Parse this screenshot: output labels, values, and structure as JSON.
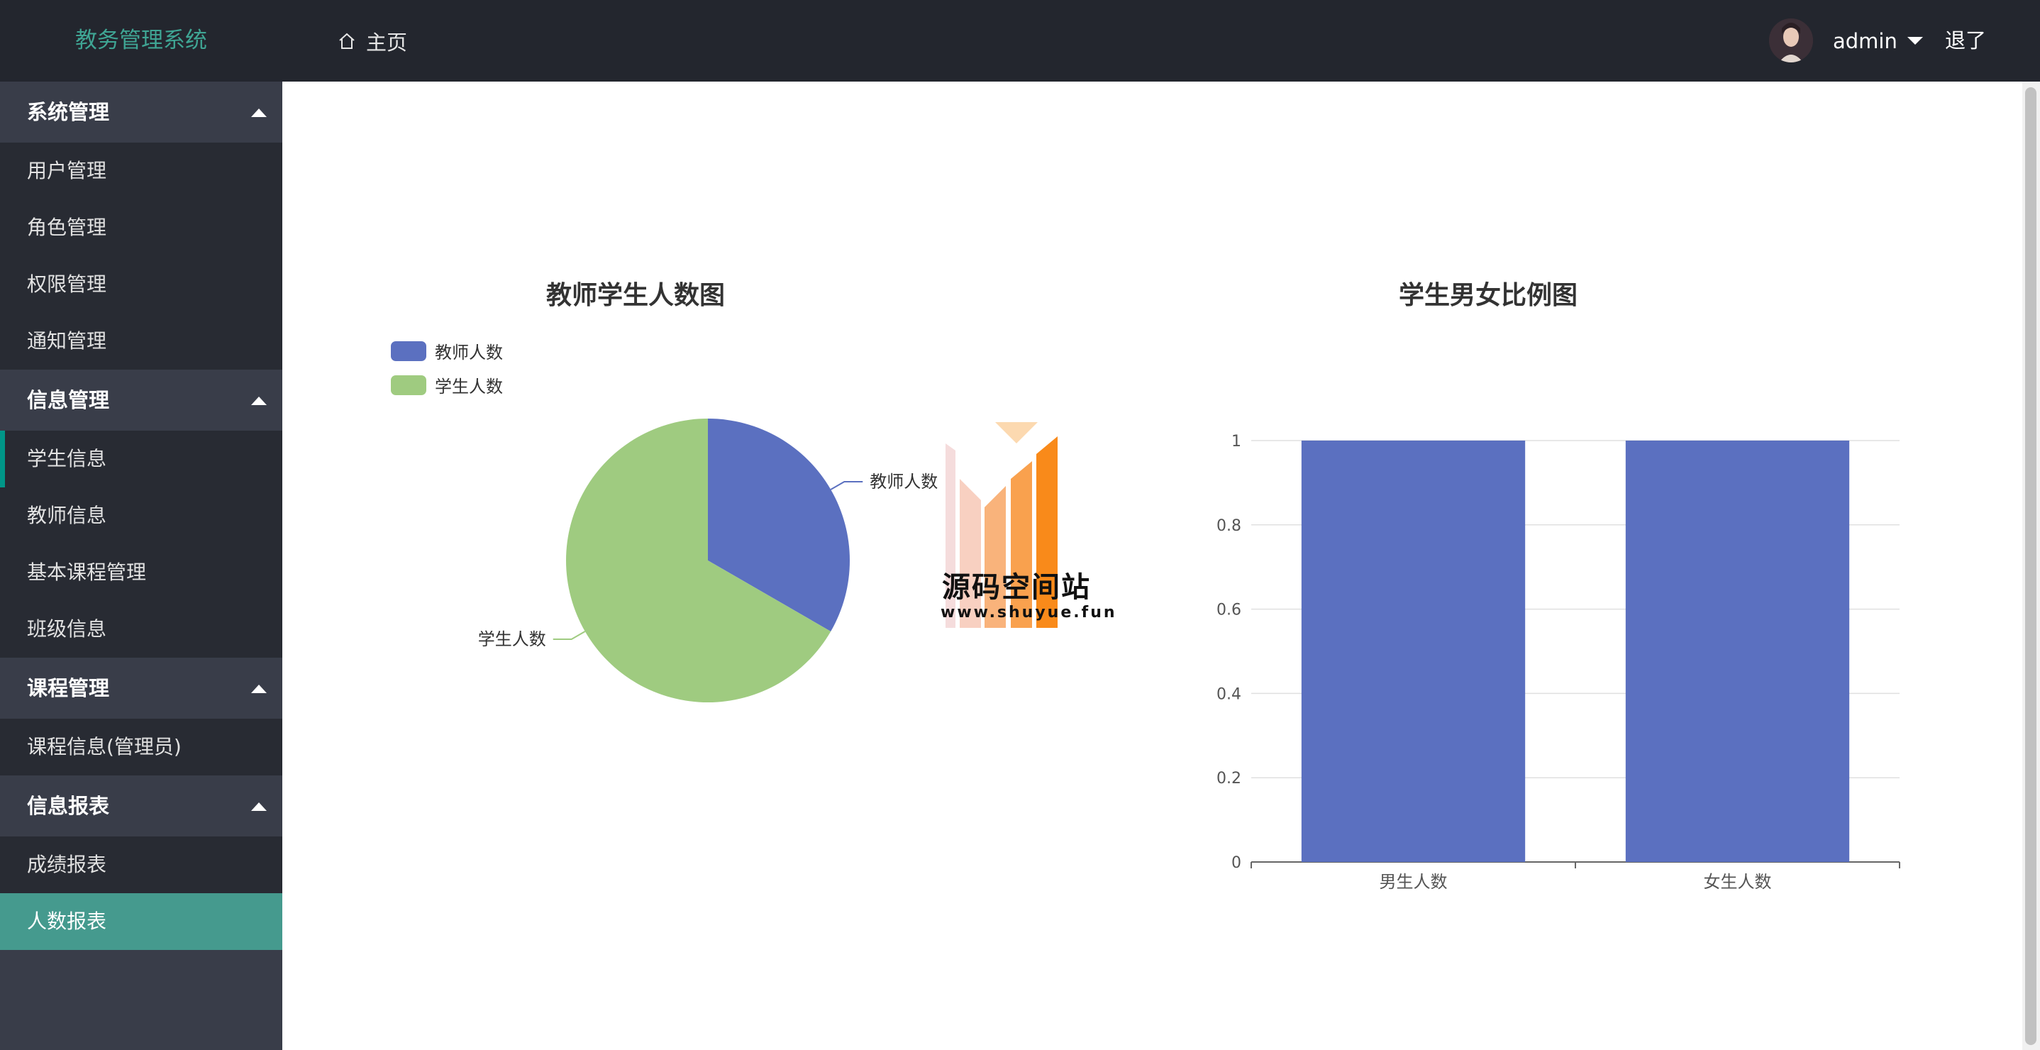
{
  "app": {
    "title": "教务管理系统"
  },
  "topbar": {
    "home_label": "主页",
    "user_name": "admin",
    "logout_label": "退了"
  },
  "sidebar": {
    "groups": [
      {
        "label": "系统管理",
        "items": [
          "用户管理",
          "角色管理",
          "权限管理",
          "通知管理"
        ]
      },
      {
        "label": "信息管理",
        "items": [
          "学生信息",
          "教师信息",
          "基本课程管理",
          "班级信息"
        ]
      },
      {
        "label": "课程管理",
        "items": [
          "课程信息(管理员)"
        ]
      },
      {
        "label": "信息报表",
        "items": [
          "成绩报表",
          "人数报表"
        ]
      }
    ],
    "active_item": "人数报表",
    "hover_item": "学生信息"
  },
  "watermark": {
    "title": "源码空间站",
    "url": "www.shuyue.fun"
  },
  "colors": {
    "accent": "#009688",
    "series_blue": "#5b70c0",
    "series_green": "#9fcb80",
    "topbar": "#23262e",
    "sidebar": "#393d49"
  },
  "chart_data": [
    {
      "type": "pie",
      "title": "教师学生人数图",
      "legend_position": "top-left",
      "slices": [
        {
          "name": "教师人数",
          "value": 1,
          "color": "#5b70c0"
        },
        {
          "name": "学生人数",
          "value": 2,
          "color": "#9fcb80"
        }
      ]
    },
    {
      "type": "bar",
      "title": "学生男女比例图",
      "categories": [
        "男生人数",
        "女生人数"
      ],
      "values": [
        1,
        1
      ],
      "ylim": [
        0,
        1
      ],
      "yticks": [
        "0",
        "0.2",
        "0.4",
        "0.6",
        "0.8",
        "1"
      ],
      "grid": true,
      "color": "#5b70c0"
    }
  ]
}
